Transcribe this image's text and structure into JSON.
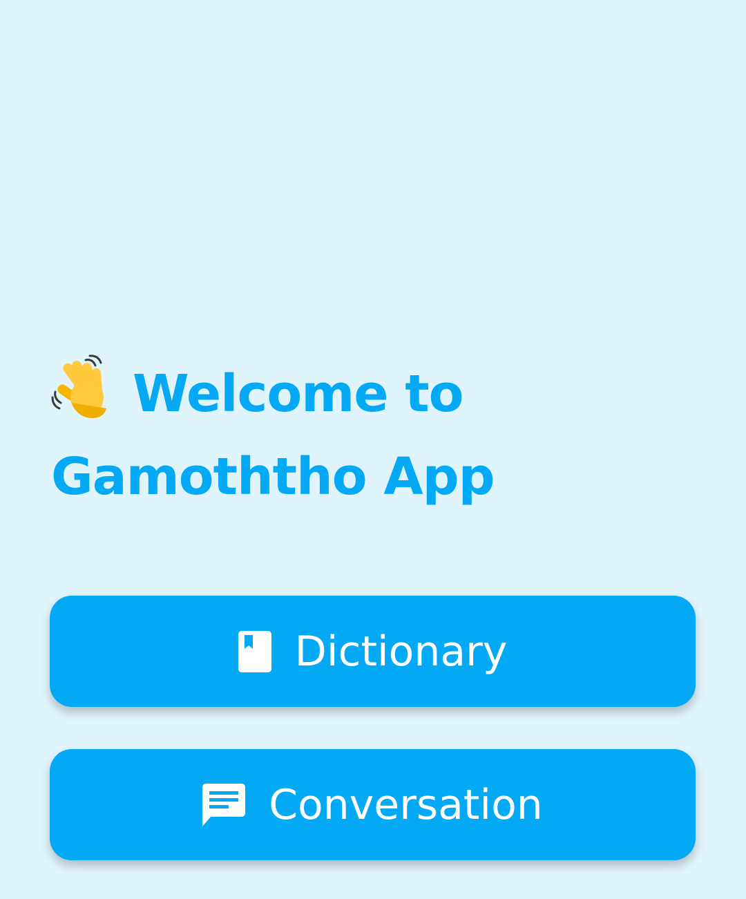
{
  "welcome": {
    "title": "Welcome to Gamoththo App",
    "emoji_icon": "waving-hand-icon"
  },
  "buttons": {
    "dictionary": {
      "label": "Dictionary",
      "icon": "book-icon"
    },
    "conversation": {
      "label": "Conversation",
      "icon": "chat-bubble-icon"
    }
  },
  "colors": {
    "background": "#E0F4FC",
    "accent": "#03A9F4",
    "button_text": "#FFFFFF"
  }
}
